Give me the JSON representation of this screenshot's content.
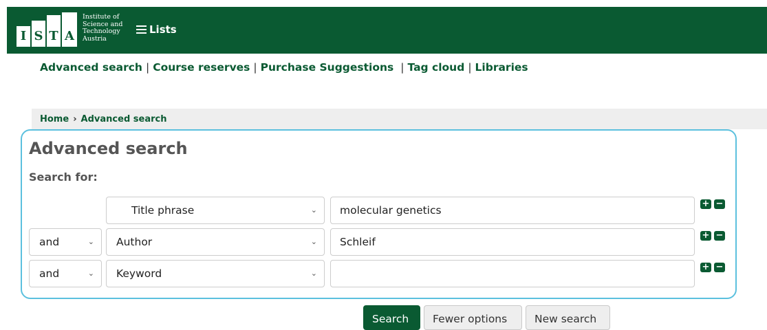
{
  "header": {
    "logo_letters": [
      "I",
      "S",
      "T",
      "A"
    ],
    "logo_text": [
      "Institute of",
      "Science and",
      "Technology",
      "Austria"
    ],
    "lists_label": "Lists"
  },
  "topnav": {
    "items": [
      "Advanced search",
      "Course reserves",
      "Purchase Suggestions",
      "Tag cloud",
      "Libraries"
    ]
  },
  "breadcrumb": {
    "home": "Home",
    "current": "Advanced search"
  },
  "panel": {
    "title": "Advanced search",
    "search_for": "Search for:",
    "rows": [
      {
        "operator": "",
        "field": "Title phrase",
        "value": "molecular genetics"
      },
      {
        "operator": "and",
        "field": "Author",
        "value": "Schleif"
      },
      {
        "operator": "and",
        "field": "Keyword",
        "value": ""
      }
    ]
  },
  "buttons": {
    "search": "Search",
    "fewer_options": "Fewer options",
    "new_search": "New search"
  },
  "colors": {
    "brand": "#0a5a32",
    "panel_border": "#5bc0de"
  }
}
